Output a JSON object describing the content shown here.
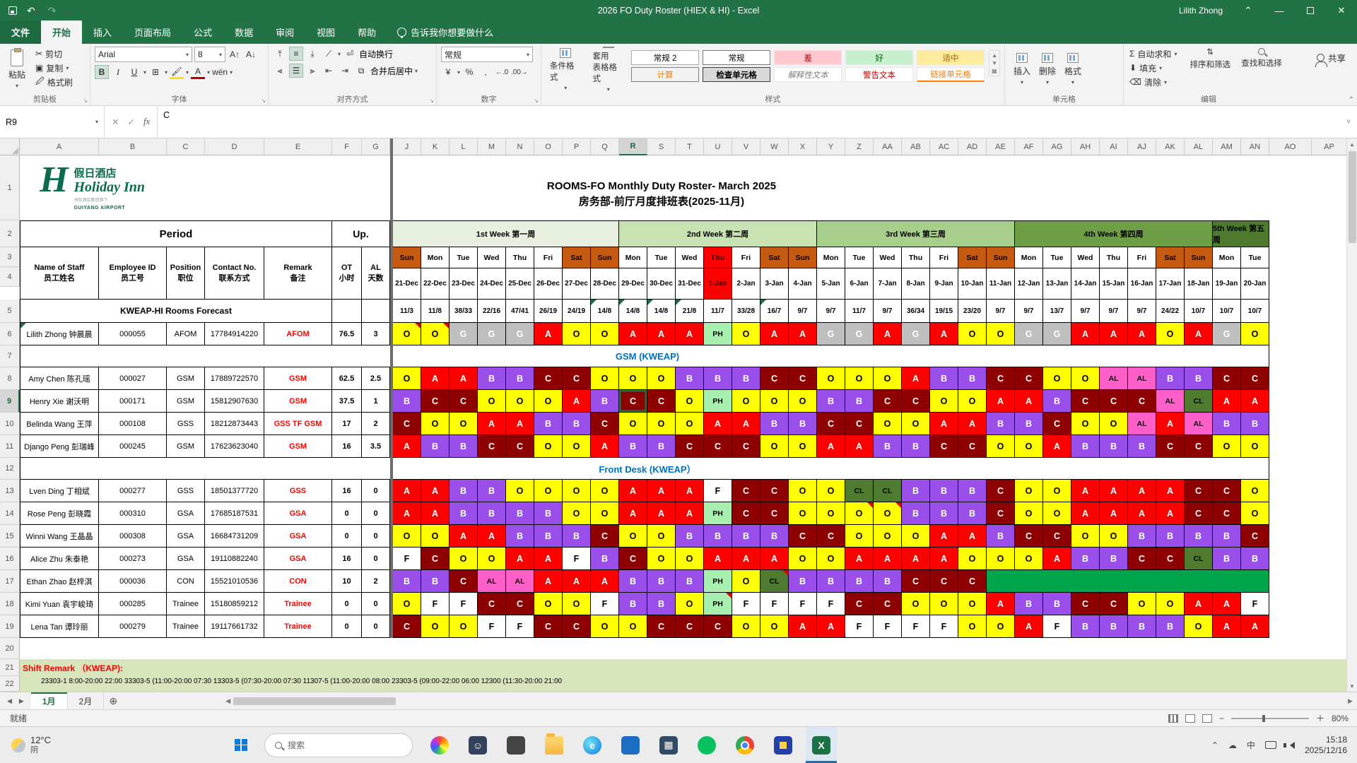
{
  "window": {
    "title": "2026 FO Duty Roster (HIEX & HI)  -  Excel",
    "user": "Lilith Zhong"
  },
  "ribbon": {
    "file_tab": "文件",
    "tabs": [
      "开始",
      "插入",
      "页面布局",
      "公式",
      "数据",
      "审阅",
      "视图",
      "帮助"
    ],
    "active_tab": "开始",
    "tell_me": "告诉我你想要做什么",
    "share": "共享",
    "clipboard": {
      "label": "剪贴板",
      "paste": "粘贴",
      "cut": "剪切",
      "copy": "复制",
      "painter": "格式刷"
    },
    "font": {
      "label": "字体",
      "family": "Arial",
      "size": "8",
      "phonetic": "wén"
    },
    "alignment": {
      "label": "对齐方式",
      "wrap": "自动换行",
      "merge": "合并后居中"
    },
    "number": {
      "label": "数字",
      "format": "常规"
    },
    "styles": {
      "label": "样式",
      "conditional": "条件格式",
      "format_table": "套用\n表格格式",
      "gallery": [
        {
          "label": "常规 2",
          "bg": "#FFFFFF",
          "fg": "#000000",
          "border": "#ababab"
        },
        {
          "label": "常规",
          "bg": "#FFFFFF",
          "fg": "#000000",
          "border": "#7a7a7a"
        },
        {
          "label": "差",
          "bg": "#FFC7CE",
          "fg": "#9C0006",
          "border": "transparent"
        },
        {
          "label": "好",
          "bg": "#C6EFCE",
          "fg": "#006100",
          "border": "transparent"
        },
        {
          "label": "适中",
          "bg": "#FFEB9C",
          "fg": "#9C6500",
          "border": "transparent"
        },
        {
          "label": "计算",
          "bg": "#F2F2F2",
          "fg": "#FA7D00",
          "border": "#7f7f7f"
        },
        {
          "label": "检查单元格",
          "bg": "#D9D9D9",
          "fg": "#000000",
          "border": "#3c3c3c",
          "bold": true
        },
        {
          "label": "解释性文本",
          "bg": "#FFFFFF",
          "fg": "#7F7F7F",
          "border": "transparent",
          "italic": true
        },
        {
          "label": "警告文本",
          "bg": "#FFFFFF",
          "fg": "#C00000",
          "border": "transparent"
        },
        {
          "label": "链接单元格",
          "bg": "#FFFFFF",
          "fg": "#FA7D00",
          "border": "transparent",
          "underline": true
        }
      ]
    },
    "cells": {
      "label": "单元格",
      "insert": "插入",
      "delete": "删除",
      "format": "格式"
    },
    "editing": {
      "label": "编辑",
      "autosum": "自动求和",
      "fill": "填充",
      "clear": "清除",
      "sort": "排序和筛选",
      "find": "查找和选择"
    }
  },
  "formula_bar": {
    "name_box": "R9",
    "value": "C"
  },
  "columns": {
    "left": [
      "A",
      "B",
      "C",
      "D",
      "E",
      "F",
      "G"
    ],
    "dates": [
      "J",
      "K",
      "L",
      "M",
      "N",
      "O",
      "P",
      "Q",
      "R",
      "S",
      "T",
      "U",
      "V",
      "W",
      "X",
      "Y",
      "Z",
      "AA",
      "AB",
      "AC",
      "AD",
      "AE",
      "AF",
      "AG",
      "AH",
      "AI",
      "AJ",
      "AK",
      "AL",
      "AM",
      "AN"
    ],
    "right": [
      "AO",
      "AP"
    ]
  },
  "selection": {
    "cell": "R9",
    "col_index": 8,
    "row_num": 9
  },
  "roster": {
    "logo": {
      "cn": "假日酒店",
      "en": "Holiday Inn",
      "sub": "洲际酒店集团旗下",
      "airport": "GUIYANG AIRPORT"
    },
    "title_en": "ROOMS-FO Monthly Duty Roster- March 2025",
    "title_cn": "房务部-前厅月度排班表(2025-11月)",
    "period_label": "Period",
    "up_label": "Up.",
    "weeks": [
      {
        "label": "1st Week 第一周",
        "span": 8,
        "bg": "#E7F0DE"
      },
      {
        "label": "2nd Week 第二周",
        "span": 7,
        "bg": "#C9E2B1"
      },
      {
        "label": "3rd Week 第三周",
        "span": 7,
        "bg": "#A8CE8C"
      },
      {
        "label": "4th Week 第四周",
        "span": 7,
        "bg": "#6E9F47"
      },
      {
        "label": "5th Week 第五周",
        "span": 2,
        "bg": "#4E7A2E"
      }
    ],
    "col_headers": [
      [
        "Name of Staff",
        "员工姓名"
      ],
      [
        "Employee ID",
        "员工号"
      ],
      [
        "Position",
        "职位"
      ],
      [
        "Contact No.",
        "联系方式"
      ],
      [
        "Remark",
        "备注"
      ],
      [
        "OT",
        "小时"
      ],
      [
        "AL",
        "天数"
      ]
    ],
    "day_names": [
      "Sun",
      "Mon",
      "Tue",
      "Wed",
      "Thu",
      "Fri",
      "Sat",
      "Sun",
      "Mon",
      "Tue",
      "Wed",
      "Thu",
      "Fri",
      "Sat",
      "Sun",
      "Mon",
      "Tue",
      "Wed",
      "Thu",
      "Fri",
      "Sat",
      "Sun",
      "Mon",
      "Tue",
      "Wed",
      "Thu",
      "Fri",
      "Sat",
      "Sun",
      "Mon",
      "Tue"
    ],
    "day_dates": [
      "21-Dec",
      "22-Dec",
      "23-Dec",
      "24-Dec",
      "25-Dec",
      "26-Dec",
      "27-Dec",
      "28-Dec",
      "29-Dec",
      "30-Dec",
      "31-Dec",
      "1-Jan",
      "2-Jan",
      "3-Jan",
      "4-Jan",
      "5-Jan",
      "6-Jan",
      "7-Jan",
      "8-Jan",
      "9-Jan",
      "10-Jan",
      "11-Jan",
      "12-Jan",
      "13-Jan",
      "14-Jan",
      "15-Jan",
      "16-Jan",
      "17-Jan",
      "18-Jan",
      "19-Jan",
      "20-Jan"
    ],
    "weekend_idx": [
      0,
      6,
      7,
      13,
      14,
      20,
      21,
      27,
      28
    ],
    "holiday_idx": [
      11
    ],
    "forecast_label": "KWEAP-HI Rooms Forecast",
    "forecast": [
      "11/3",
      "11/8",
      "38/33",
      "22/16",
      "47/41",
      "26/19",
      "24/19",
      "14/8",
      "14/8",
      "14/8",
      "21/8",
      "11/7",
      "33/28",
      "16/7",
      "9/7",
      "9/7",
      "11/7",
      "9/7",
      "36/34",
      "19/15",
      "23/20",
      "9/7",
      "9/7",
      "13/7",
      "9/7",
      "9/7",
      "9/7",
      "24/22",
      "10/7",
      "10/7",
      "10/7"
    ],
    "forecast_marks": [
      7,
      8,
      9,
      10,
      13
    ],
    "rows": [
      {
        "type": "staff",
        "num": 6,
        "name": "Lilith Zhong 钟晨晨",
        "id": "000055",
        "pos": "AFOM",
        "contact": "17784914220",
        "remark": "AFOM",
        "ot": "76.5",
        "al": "3",
        "name_mark": true,
        "marks": [
          0,
          1
        ],
        "shifts": [
          "O",
          "O",
          "G",
          "G",
          "G",
          "A",
          "O",
          "O",
          "A",
          "A",
          "A",
          "PH",
          "O",
          "A",
          "A",
          "G",
          "G",
          "A",
          "G",
          "A",
          "O",
          "O",
          "G",
          "G",
          "A",
          "A",
          "A",
          "O",
          "A",
          "G",
          "O"
        ]
      },
      {
        "type": "section",
        "num": 7,
        "label": "GSM (KWEAP)"
      },
      {
        "type": "staff",
        "num": 8,
        "name": "Amy Chen 陈孔瑶",
        "id": "000027",
        "pos": "GSM",
        "contact": "17889722570",
        "remark": "GSM",
        "ot": "62.5",
        "al": "2.5",
        "shifts": [
          "O",
          "A",
          "A",
          "B",
          "B",
          "C",
          "C",
          "O",
          "O",
          "O",
          "B",
          "B",
          "B",
          "C",
          "C",
          "O",
          "O",
          "O",
          "A",
          "B",
          "B",
          "C",
          "C",
          "O",
          "O",
          "AL",
          "AL",
          "B",
          "B",
          "C",
          "C"
        ]
      },
      {
        "type": "staff",
        "num": 9,
        "name": "Henry Xie 谢沃明",
        "id": "000171",
        "pos": "GSM",
        "contact": "15812907630",
        "remark": "GSM",
        "ot": "37.5",
        "al": "1",
        "selected_idx": 8,
        "shifts": [
          "B",
          "C",
          "C",
          "O",
          "O",
          "O",
          "A",
          "B",
          "C",
          "C",
          "O",
          "PH",
          "O",
          "O",
          "O",
          "B",
          "B",
          "C",
          "C",
          "O",
          "O",
          "A",
          "A",
          "B",
          "C",
          "C",
          "C",
          "AL",
          "CL",
          "A",
          "A"
        ]
      },
      {
        "type": "staff",
        "num": 10,
        "name": "Belinda Wang 王萍",
        "id": "000108",
        "pos": "GSS",
        "contact": "18212873443",
        "remark": "GSS TF GSM",
        "ot": "17",
        "al": "2",
        "shifts": [
          "C",
          "O",
          "O",
          "A",
          "A",
          "B",
          "B",
          "C",
          "O",
          "O",
          "O",
          "A",
          "A",
          "B",
          "B",
          "C",
          "C",
          "O",
          "O",
          "A",
          "A",
          "B",
          "B",
          "C",
          "O",
          "O",
          "AL",
          "A",
          "AL",
          "B",
          "B"
        ]
      },
      {
        "type": "staff",
        "num": 11,
        "name": "Django Peng 彭瑞峰",
        "id": "000245",
        "pos": "GSM",
        "contact": "17623623040",
        "remark": "GSM",
        "ot": "16",
        "al": "3.5",
        "shifts": [
          "A",
          "B",
          "B",
          "C",
          "C",
          "O",
          "O",
          "A",
          "B",
          "B",
          "C",
          "C",
          "C",
          "O",
          "O",
          "A",
          "A",
          "B",
          "B",
          "C",
          "C",
          "O",
          "O",
          "A",
          "B",
          "B",
          "B",
          "C",
          "C",
          "O",
          "O"
        ]
      },
      {
        "type": "section",
        "num": 12,
        "label": "Front Desk (KWEAP）"
      },
      {
        "type": "staff",
        "num": 13,
        "name": "Lven Ding 丁相斌",
        "id": "000277",
        "pos": "GSS",
        "contact": "18501377720",
        "remark": "GSS",
        "ot": "16",
        "al": "0",
        "shifts": [
          "A",
          "A",
          "B",
          "B",
          "O",
          "O",
          "O",
          "O",
          "A",
          "A",
          "A",
          "F",
          "C",
          "C",
          "O",
          "O",
          "CL",
          "CL",
          "B",
          "B",
          "B",
          "C",
          "O",
          "O",
          "A",
          "A",
          "A",
          "A",
          "C",
          "C",
          "O"
        ]
      },
      {
        "type": "staff",
        "num": 14,
        "name": "Rose Peng 彭晓霞",
        "id": "000310",
        "pos": "GSA",
        "contact": "17685187531",
        "remark": "GSA",
        "ot": "0",
        "al": "0",
        "marks": [
          16,
          17
        ],
        "shifts": [
          "A",
          "A",
          "B",
          "B",
          "B",
          "B",
          "O",
          "O",
          "A",
          "A",
          "A",
          "PH",
          "C",
          "C",
          "O",
          "O",
          "O",
          "O",
          "B",
          "B",
          "B",
          "C",
          "O",
          "O",
          "A",
          "A",
          "A",
          "A",
          "C",
          "C",
          "O"
        ]
      },
      {
        "type": "staff",
        "num": 15,
        "name": "Winni Wang 王晶晶",
        "id": "000308",
        "pos": "GSA",
        "contact": "16684731209",
        "remark": "GSA",
        "ot": "0",
        "al": "0",
        "shifts": [
          "O",
          "O",
          "A",
          "A",
          "B",
          "B",
          "B",
          "C",
          "O",
          "O",
          "B",
          "B",
          "B",
          "B",
          "C",
          "C",
          "O",
          "O",
          "O",
          "A",
          "A",
          "B",
          "C",
          "C",
          "O",
          "O",
          "B",
          "B",
          "B",
          "B",
          "C"
        ]
      },
      {
        "type": "staff",
        "num": 16,
        "name": "Alice Zhu 朱泰艳",
        "id": "000273",
        "pos": "GSA",
        "contact": "19110882240",
        "remark": "GSA",
        "ot": "16",
        "al": "0",
        "shifts": [
          "F",
          "C",
          "O",
          "O",
          "A",
          "A",
          "F",
          "B",
          "C",
          "O",
          "O",
          "A",
          "A",
          "A",
          "O",
          "O",
          "A",
          "A",
          "A",
          "A",
          "O",
          "O",
          "O",
          "A",
          "B",
          "B",
          "C",
          "C",
          "CL",
          "B",
          "B"
        ]
      },
      {
        "type": "staff",
        "num": 17,
        "name": "Ethan Zhao 赵梓淇",
        "id": "000036",
        "pos": "CON",
        "contact": "15521010536",
        "remark": "CON",
        "ot": "10",
        "al": "2",
        "marks": [
          13
        ],
        "green_span": 10,
        "shifts": [
          "B",
          "B",
          "C",
          "AL",
          "AL",
          "A",
          "A",
          "A",
          "B",
          "B",
          "B",
          "PH",
          "O",
          "CL",
          "B",
          "B",
          "B",
          "B",
          "C",
          "C",
          "C"
        ]
      },
      {
        "type": "staff",
        "num": 18,
        "name": "Kimi Yuan 袁宇峻琦",
        "id": "000285",
        "pos": "Trainee",
        "contact": "15180859212",
        "remark": "Trainee",
        "ot": "0",
        "al": "0",
        "marks": [
          11
        ],
        "shifts": [
          "O",
          "F",
          "F",
          "C",
          "C",
          "O",
          "O",
          "F",
          "B",
          "B",
          "O",
          "PH",
          "F",
          "F",
          "F",
          "F",
          "C",
          "C",
          "O",
          "O",
          "O",
          "A",
          "B",
          "B",
          "C",
          "C",
          "O",
          "O",
          "A",
          "A",
          "F"
        ]
      },
      {
        "type": "staff",
        "num": 19,
        "name": "Lena Tan 谭玲丽",
        "id": "000279",
        "pos": "Trainee",
        "contact": "19117661732",
        "remark": "Trainee",
        "ot": "0",
        "al": "0",
        "shifts": [
          "C",
          "O",
          "O",
          "F",
          "F",
          "C",
          "C",
          "O",
          "O",
          "C",
          "C",
          "C",
          "O",
          "O",
          "A",
          "A",
          "F",
          "F",
          "F",
          "F",
          "O",
          "O",
          "A",
          "F",
          "B",
          "B",
          "B",
          "B",
          "O",
          "A",
          "A"
        ]
      },
      {
        "type": "empty",
        "num": 20
      }
    ],
    "remark_title": "Shift Remark （KWEAP):",
    "remark_detail": "23303-1 8:00-20:00        22:00        33303-5 (11:00-20:00        07:30        13303-5 (07:30-20:00        07:30        11307-5 (11:00-20:00        08:00        23303-5 (09:00-22:00        06:00        12300 (11:30-20:00        21:00"
  },
  "shift_palette": {
    "O": {
      "bg": "#FFFF00",
      "fg": "#000000"
    },
    "A": {
      "bg": "#FF0000",
      "fg": "#FFFFFF"
    },
    "B": {
      "bg": "#9B4FEA",
      "fg": "#FFFFFF"
    },
    "C": {
      "bg": "#8E0000",
      "fg": "#FFFFFF"
    },
    "G": {
      "bg": "#BFBFBF",
      "fg": "#FFFFFF"
    },
    "PH": {
      "bg": "#A8F0B0",
      "fg": "#000000"
    },
    "F": {
      "bg": "#FFFFFF",
      "fg": "#000000"
    },
    "AL": {
      "bg": "#FF5FC8",
      "fg": "#000000"
    },
    "CL": {
      "bg": "#4E7B2F",
      "fg": "#000000"
    }
  },
  "special_colors": {
    "weekend": "#C55A11",
    "holiday": "#FF0000",
    "merge_green": "#00A44A",
    "remark_bg": "#D7E4BC",
    "accent": "#217346"
  },
  "sheet_tabs": {
    "tabs": [
      "1月",
      "2月"
    ],
    "active": "1月"
  },
  "status_bar": {
    "ready": "就绪",
    "zoom": "80%"
  },
  "taskbar": {
    "weather_temp": "12°C",
    "weather_desc": "阴",
    "search_placeholder": "搜索",
    "apps": [
      "paint-icon",
      "contacts-icon",
      "display-icon",
      "file-explorer-icon",
      "edge-icon",
      "teams-icon",
      "calculator-icon",
      "wechat-icon",
      "chrome-icon",
      "netease-icon",
      "excel-icon"
    ],
    "tray_lang": "中",
    "time": "15:18",
    "date": "2025/12/16"
  }
}
